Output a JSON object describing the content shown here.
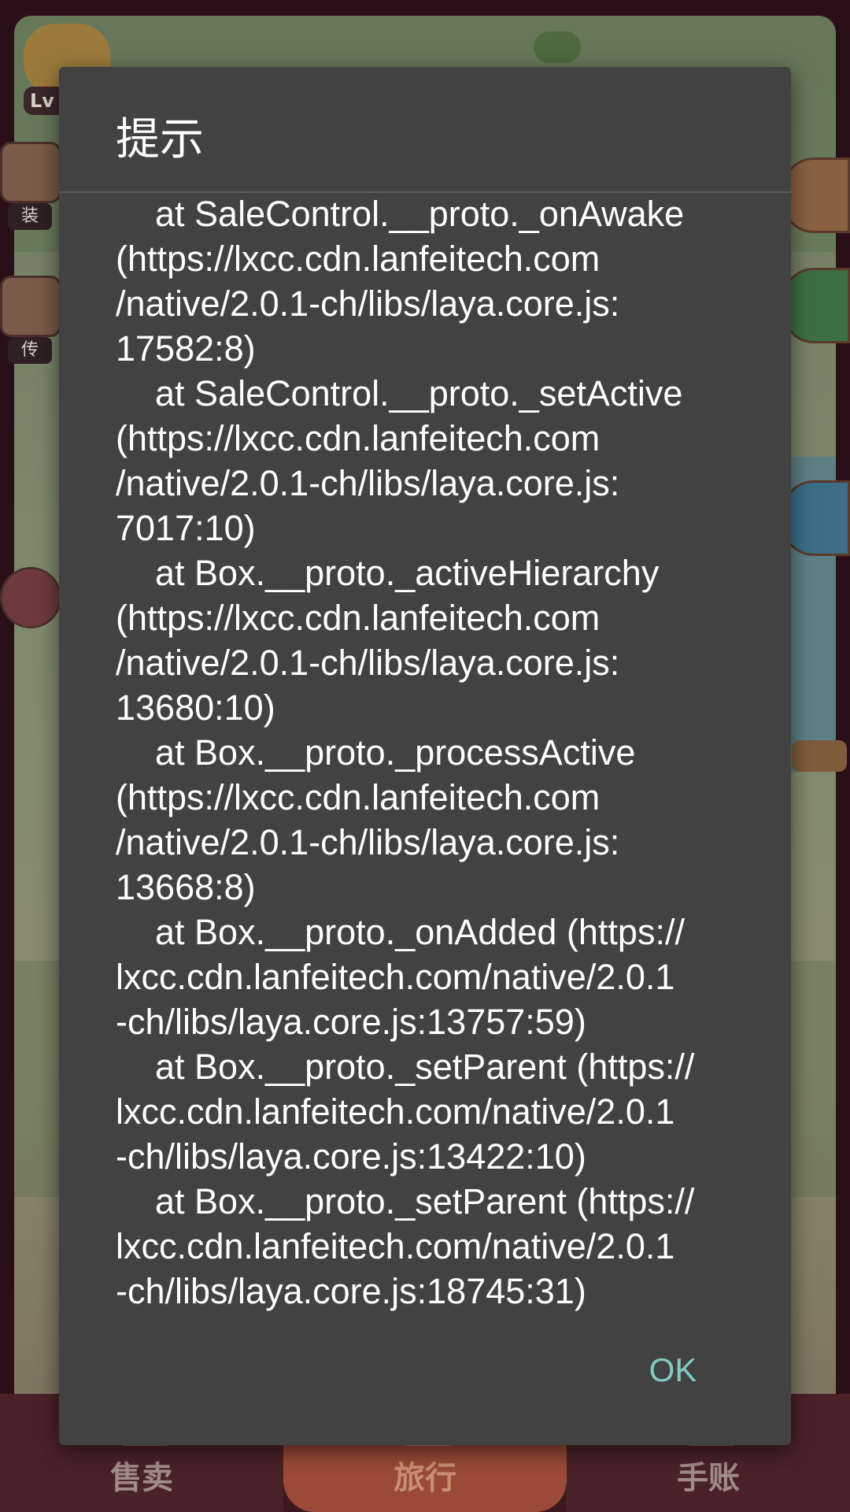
{
  "background": {
    "level_badge": "Lv",
    "left_labels": [
      "装",
      "传"
    ],
    "bottom_nav": {
      "sell": "售卖",
      "travel": "旅行",
      "ledger": "手账"
    }
  },
  "dialog": {
    "title": "提示",
    "message_lines": [
      "    at SaleControl.__proto._onAwake",
      "(https://lxcc.cdn.lanfeitech.com",
      "/native/2.0.1-ch/libs/laya.core.js:",
      "17582:8)",
      "    at SaleControl.__proto._setActive",
      "(https://lxcc.cdn.lanfeitech.com",
      "/native/2.0.1-ch/libs/laya.core.js:",
      "7017:10)",
      "    at Box.__proto._activeHierarchy",
      "(https://lxcc.cdn.lanfeitech.com",
      "/native/2.0.1-ch/libs/laya.core.js:",
      "13680:10)",
      "    at Box.__proto._processActive",
      "(https://lxcc.cdn.lanfeitech.com",
      "/native/2.0.1-ch/libs/laya.core.js:",
      "13668:8)",
      "    at Box.__proto._onAdded (https://",
      "lxcc.cdn.lanfeitech.com/native/2.0.1",
      "-ch/libs/laya.core.js:13757:59)",
      "    at Box.__proto._setParent (https://",
      "lxcc.cdn.lanfeitech.com/native/2.0.1",
      "-ch/libs/laya.core.js:13422:10)",
      "    at Box.__proto._setParent (https://",
      "lxcc.cdn.lanfeitech.com/native/2.0.1",
      "-ch/libs/laya.core.js:18745:31)"
    ],
    "ok_label": "OK"
  },
  "colors": {
    "dialog_bg": "#424242",
    "accent": "#80cbc4",
    "text": "#ffffff"
  }
}
